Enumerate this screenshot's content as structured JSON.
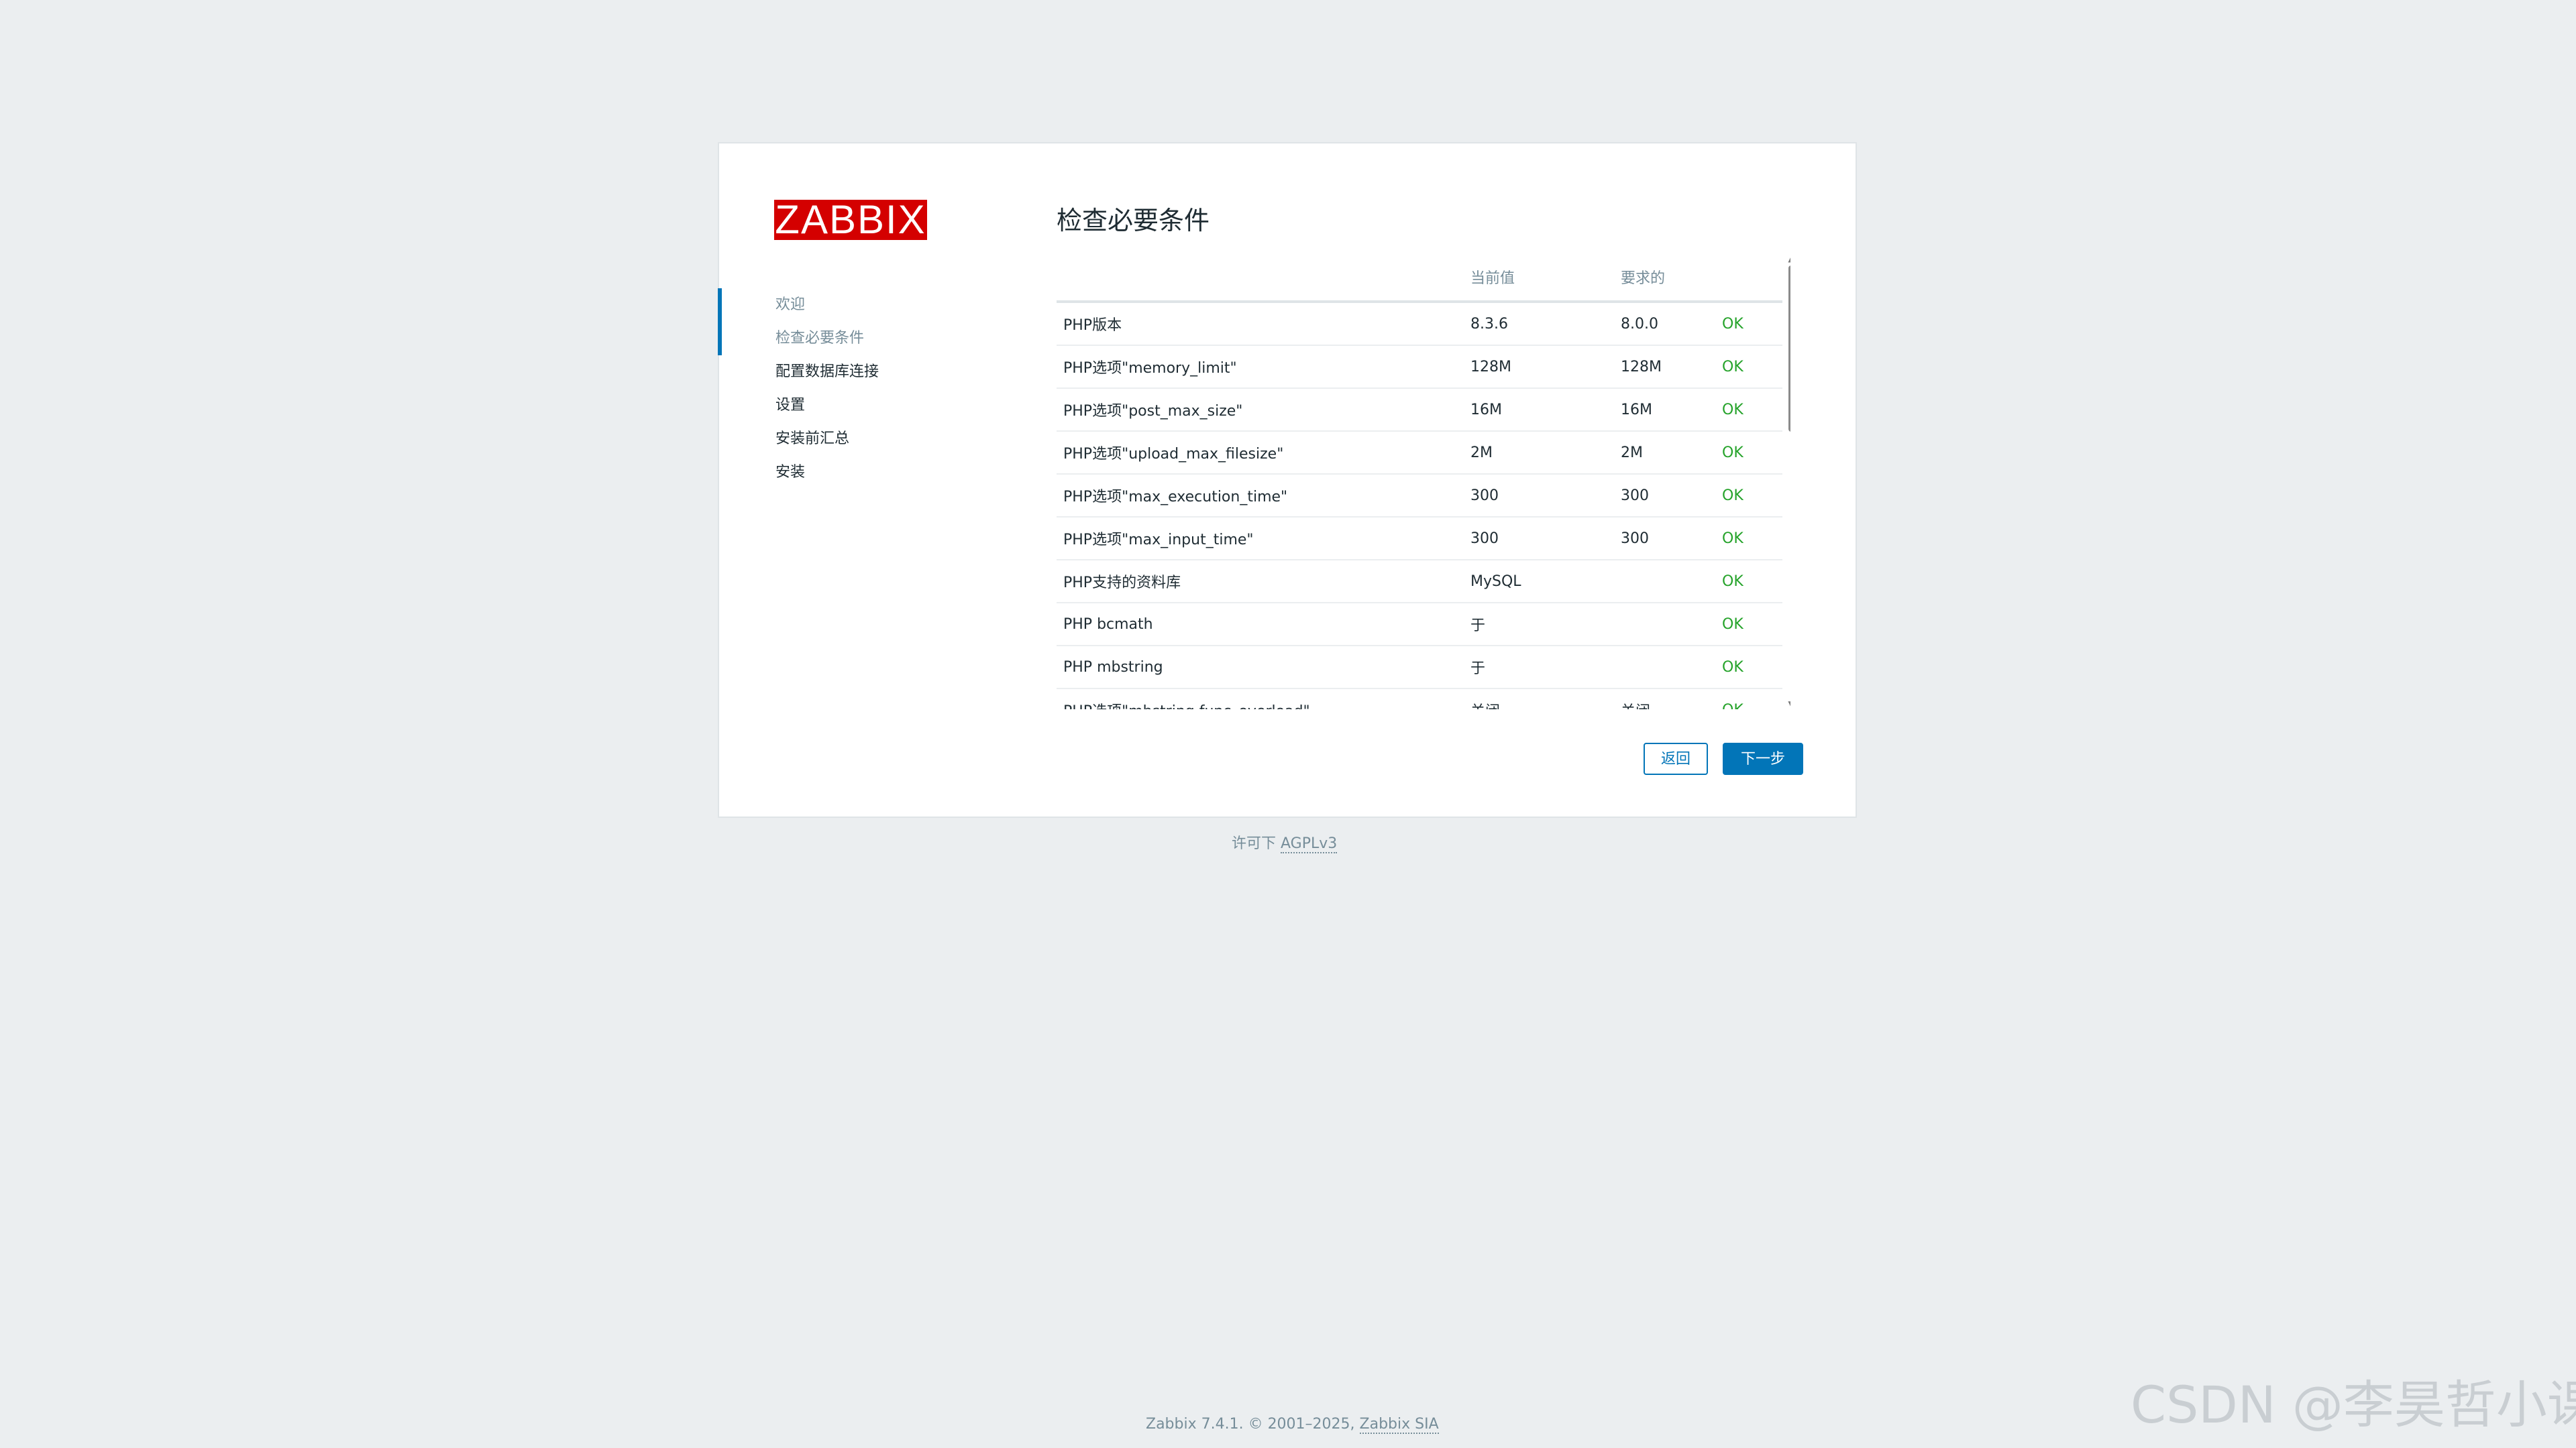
{
  "logo": {
    "text": "ZABBIX",
    "color": "#d40000"
  },
  "steps": [
    {
      "label": "欢迎",
      "state": "done"
    },
    {
      "label": "检查必要条件",
      "state": "current"
    },
    {
      "label": "配置数据库连接",
      "state": "pending"
    },
    {
      "label": "设置",
      "state": "pending"
    },
    {
      "label": "安装前汇总",
      "state": "pending"
    },
    {
      "label": "安装",
      "state": "pending"
    }
  ],
  "main": {
    "title": "检查必要条件",
    "columns": {
      "name": "",
      "current": "当前值",
      "required": "要求的",
      "status": ""
    },
    "rows": [
      {
        "name": "PHP版本",
        "current": "8.3.6",
        "required": "8.0.0",
        "status": "OK"
      },
      {
        "name": "PHP选项\"memory_limit\"",
        "current": "128M",
        "required": "128M",
        "status": "OK"
      },
      {
        "name": "PHP选项\"post_max_size\"",
        "current": "16M",
        "required": "16M",
        "status": "OK"
      },
      {
        "name": "PHP选项\"upload_max_filesize\"",
        "current": "2M",
        "required": "2M",
        "status": "OK"
      },
      {
        "name": "PHP选项\"max_execution_time\"",
        "current": "300",
        "required": "300",
        "status": "OK"
      },
      {
        "name": "PHP选项\"max_input_time\"",
        "current": "300",
        "required": "300",
        "status": "OK"
      },
      {
        "name": "PHP支持的资料库",
        "current": "MySQL",
        "required": "",
        "status": "OK"
      },
      {
        "name": "PHP bcmath",
        "current": "于",
        "required": "",
        "status": "OK"
      },
      {
        "name": "PHP mbstring",
        "current": "于",
        "required": "",
        "status": "OK"
      },
      {
        "name": "PHP选项\"mbstring.func_overload\"",
        "current": "关闭",
        "required": "关闭",
        "status": "OK"
      }
    ],
    "scroll_position": 0.0
  },
  "buttons": {
    "back": "返回",
    "next": "下一步"
  },
  "license": {
    "prefix": "许可下 ",
    "link": "AGPLv3"
  },
  "footer": {
    "prefix": "Zabbix 7.4.1. © 2001–2025, ",
    "link": "Zabbix SIA"
  },
  "watermark": "CSDN @李昊哲小课",
  "colors": {
    "accent": "#0275b8",
    "ok": "#26a32b",
    "background": "#ebeef0",
    "muted": "#768d99"
  }
}
